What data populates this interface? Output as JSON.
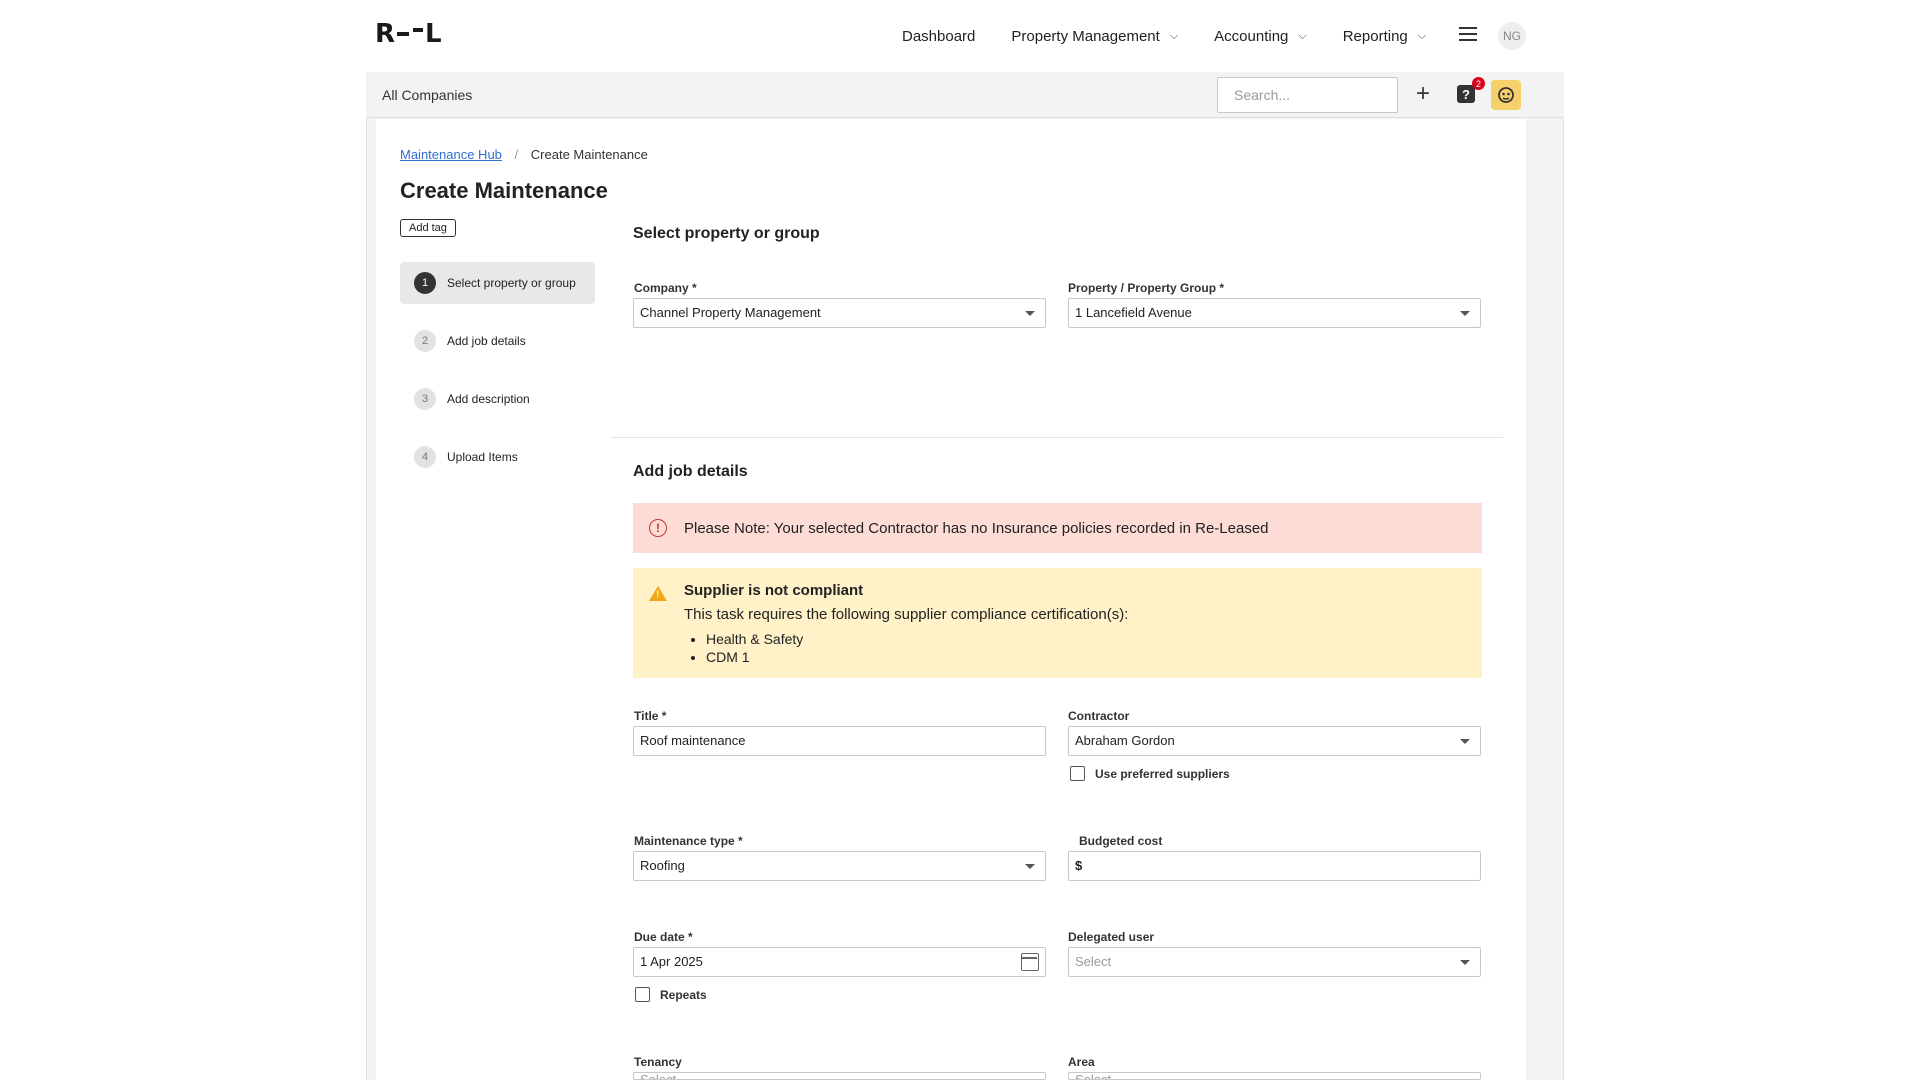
{
  "logo": {
    "left": "R",
    "right": "L"
  },
  "nav": {
    "items": [
      {
        "label": "Dashboard",
        "has_menu": false
      },
      {
        "label": "Property Management",
        "has_menu": true
      },
      {
        "label": "Accounting",
        "has_menu": true
      },
      {
        "label": "Reporting",
        "has_menu": true
      }
    ],
    "avatar": "NG"
  },
  "subbar": {
    "title": "All Companies",
    "search_placeholder": "Search...",
    "help_badge": "2"
  },
  "breadcrumb": {
    "parent": "Maintenance Hub",
    "separator": "/",
    "current": "Create Maintenance"
  },
  "page": {
    "title": "Create Maintenance",
    "add_tag_label": "Add tag"
  },
  "steps": [
    {
      "num": "1",
      "label": "Select property or group",
      "active": true
    },
    {
      "num": "2",
      "label": "Add job details",
      "active": false
    },
    {
      "num": "3",
      "label": "Add description",
      "active": false
    },
    {
      "num": "4",
      "label": "Upload Items",
      "active": false
    }
  ],
  "section1": {
    "title": "Select property or group",
    "company_label": "Company *",
    "company_value": "Channel Property Management",
    "property_label": "Property / Property Group *",
    "property_value": "1 Lancefield Avenue"
  },
  "section2": {
    "title": "Add job details",
    "error_text": "Please Note: Your selected Contractor has no Insurance policies recorded in Re-Leased",
    "warn_title": "Supplier is not compliant",
    "warn_text": "This task requires the following supplier compliance certification(s):",
    "warn_items": [
      "Health & Safety",
      "CDM 1"
    ],
    "title_label": "Title *",
    "title_value": "Roof maintenance",
    "contractor_label": "Contractor",
    "contractor_value": "Abraham Gordon",
    "preferred_label": "Use preferred suppliers",
    "mtype_label": "Maintenance type *",
    "mtype_value": "Roofing",
    "budget_label": "Budgeted cost",
    "budget_prefix": "$",
    "due_label": "Due date *",
    "due_value": "1 Apr 2025",
    "delegated_label": "Delegated user",
    "delegated_placeholder": "Select",
    "repeats_label": "Repeats",
    "tenancy_label": "Tenancy",
    "area_label": "Area",
    "tenancy_placeholder": "Select",
    "area_placeholder": "Select"
  },
  "colors": {
    "link": "#2f6fd1",
    "error_bg": "#fddcd6",
    "warn_bg": "#fff1c8",
    "badge": "#d9001b",
    "bot": "#f6d06a"
  }
}
